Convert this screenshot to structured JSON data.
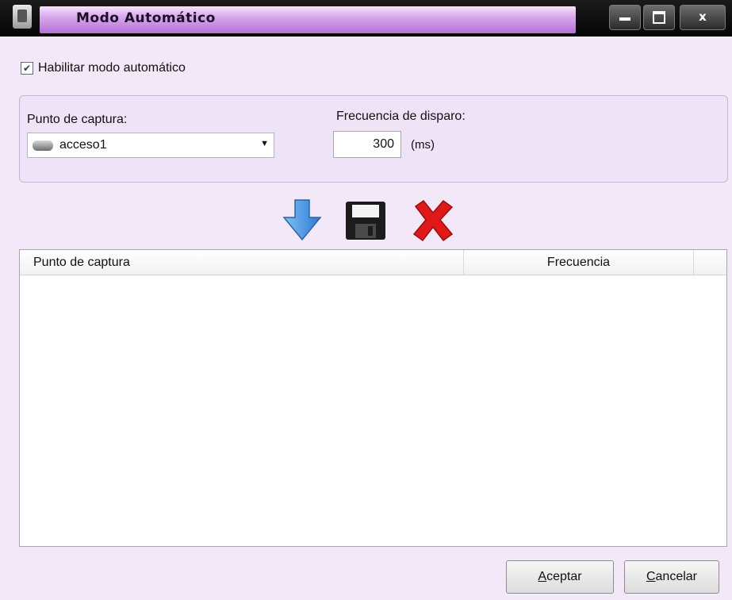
{
  "window": {
    "title": "Modo Automático",
    "controls": {
      "minimize_icon": "minimize-icon",
      "maximize_icon": "maximize-icon",
      "close_label": "x"
    }
  },
  "enable": {
    "label": "Habilitar modo automático",
    "checked": true
  },
  "capture": {
    "label": "Punto de captura:",
    "selected_value": "acceso1",
    "icon": "camera-icon"
  },
  "frequency": {
    "label": "Frecuencia de disparo:",
    "value": "300",
    "unit": "(ms)"
  },
  "toolbar": {
    "add_icon": "down-arrow-icon",
    "save_icon": "floppy-save-icon",
    "delete_icon": "red-x-delete-icon",
    "colors": {
      "arrow": "#3b8de0",
      "delete": "#e01818",
      "save": "#1a1a1a"
    }
  },
  "table": {
    "columns": [
      "Punto de captura",
      "Frecuencia"
    ],
    "rows": []
  },
  "buttons": {
    "accept_prefix": "A",
    "accept_rest": "ceptar",
    "cancel_prefix": "C",
    "cancel_rest": "ancelar"
  },
  "colors": {
    "title_gradient_end": "#b573d4",
    "background": "#f2e8f8"
  }
}
